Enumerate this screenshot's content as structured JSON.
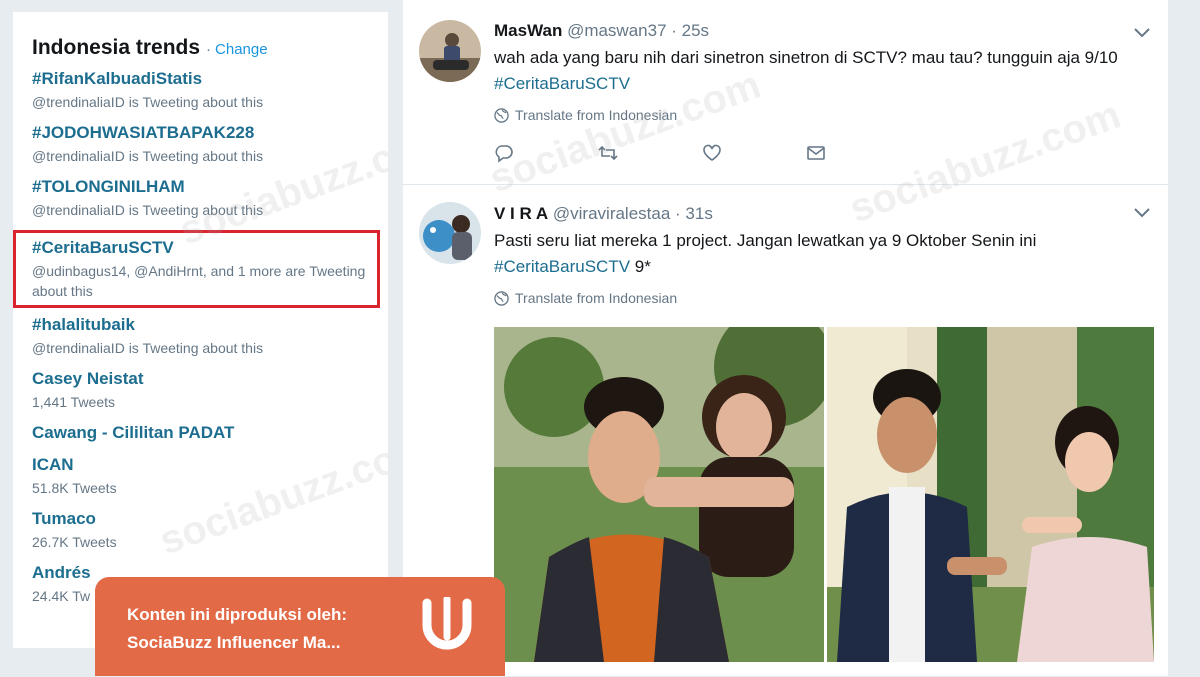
{
  "trends": {
    "title": "Indonesia trends",
    "separator": "·",
    "change_label": "Change",
    "items": [
      {
        "name": "#RifanKalbuadiStatis",
        "sub": "@trendinaliaID is Tweeting about this"
      },
      {
        "name": "#JODOHWASIATBAPAK228",
        "sub": "@trendinaliaID is Tweeting about this"
      },
      {
        "name": "#TOLONGINILHAM",
        "sub": "@trendinaliaID is Tweeting about this"
      },
      {
        "name": "#CeritaBaruSCTV",
        "sub": "@udinbagus14, @AndiHrnt, and 1 more are Tweeting about this",
        "highlighted": true
      },
      {
        "name": "#halalitubaik",
        "sub": "@trendinaliaID is Tweeting about this"
      },
      {
        "name": "Casey Neistat",
        "sub": "1,441 Tweets"
      },
      {
        "name": "Cawang - Cililitan PADAT",
        "sub": ""
      },
      {
        "name": "ICAN",
        "sub": "51.8K Tweets"
      },
      {
        "name": "Tumaco",
        "sub": "26.7K Tweets"
      },
      {
        "name": "Andrés",
        "sub": "24.4K Tw"
      }
    ]
  },
  "tweets": [
    {
      "user": "MasWan",
      "handle": "@maswan37",
      "time": "· 25s",
      "text_before": "wah ada yang baru nih dari sinetron sinetron di SCTV? mau tau? tungguin aja 9/10 ",
      "hashtag": "#CeritaBaruSCTV",
      "text_after": "",
      "translate": "Translate from Indonesian"
    },
    {
      "user": "V I R A",
      "handle": "@viraviralestaa",
      "time": "· 31s",
      "text_before": "Pasti seru liat mereka 1 project. Jangan lewatkan ya 9 Oktober Senin ini ",
      "hashtag": "#CeritaBaruSCTV",
      "text_after": " 9*",
      "translate": "Translate from Indonesian"
    }
  ],
  "icons": {
    "reply": "reply-icon",
    "retweet": "retweet-icon",
    "like": "heart-icon",
    "dm": "envelope-icon",
    "caret": "chevron-down-icon",
    "globe": "globe-icon"
  },
  "banner": {
    "line1": "Konten ini diproduksi oleh:",
    "line2": "SociaBuzz Influencer Ma..."
  },
  "watermark": "sociabuzz.com",
  "colors": {
    "link": "#1c6d8f",
    "highlight_border": "#d9232f",
    "banner": "#e36a46",
    "muted": "#657786"
  }
}
